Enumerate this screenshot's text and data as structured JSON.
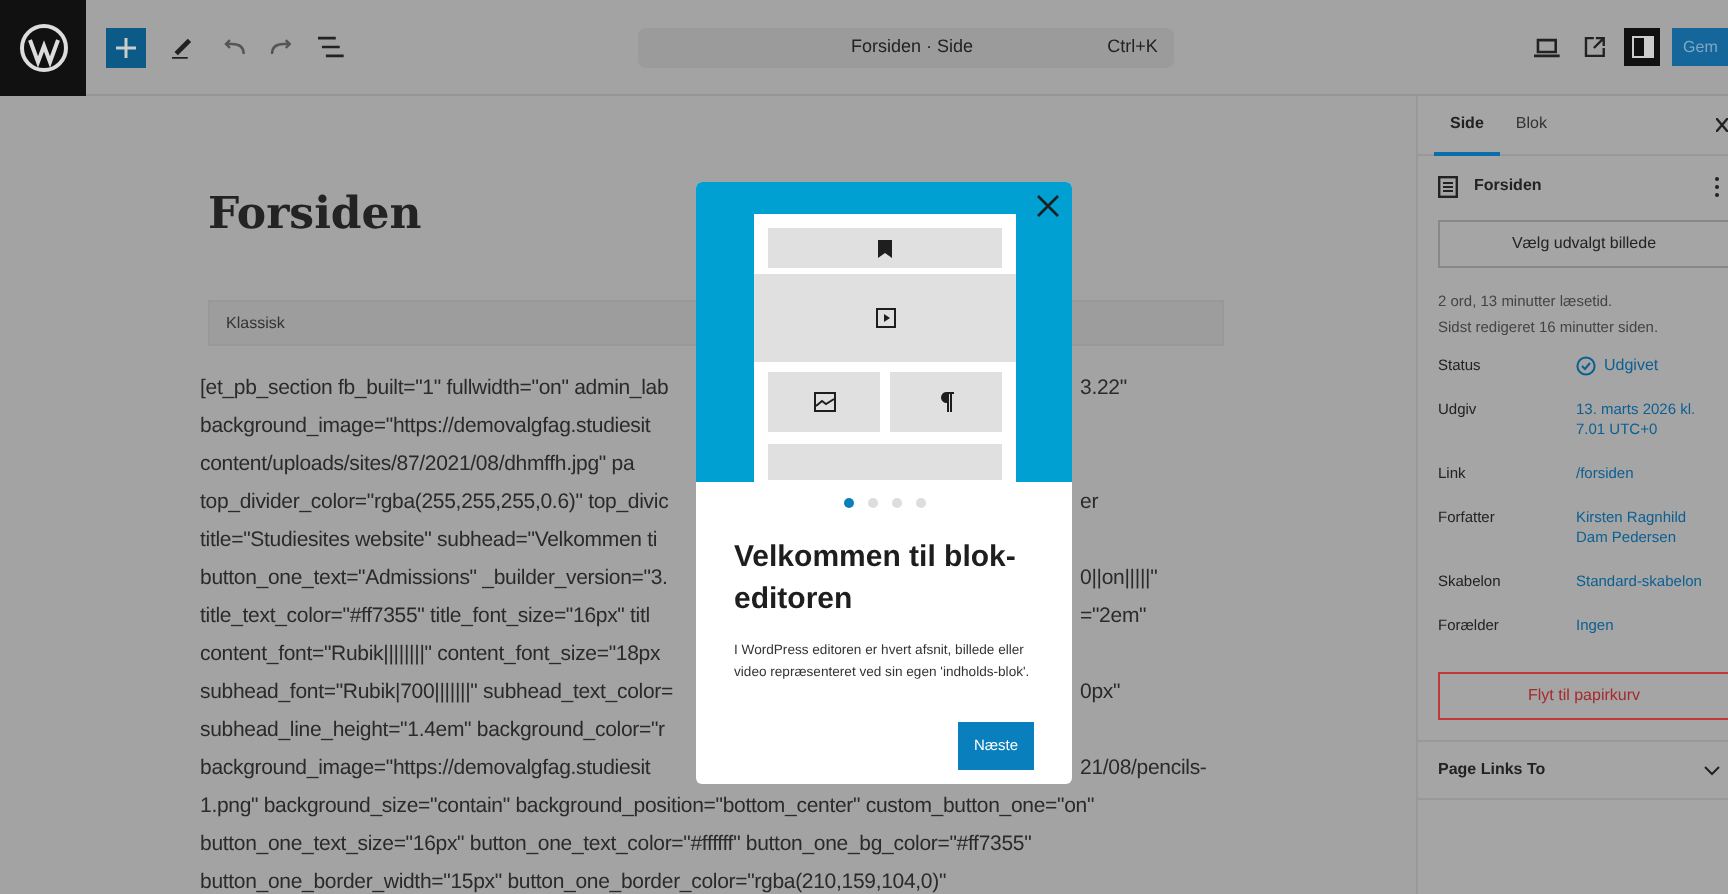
{
  "toolbar": {
    "document_title": "Forsiden · Side",
    "shortcut": "Ctrl+K",
    "save_button": "Gem"
  },
  "editor": {
    "title": "Forsiden",
    "block_label": "Klassisk",
    "lines": [
      {
        "kind": "split",
        "left": "[et_pb_section fb_built=\"1\" fullwidth=\"on\" admin_lab",
        "right": "3.22\""
      },
      {
        "kind": "split",
        "left": "background_image=\"https://demovalgfag.studiesit"
      },
      {
        "kind": "split",
        "left": "content/uploads/sites/87/2021/08/dhmffh.jpg\" pa"
      },
      {
        "kind": "split",
        "left": "top_divider_color=\"rgba(255,255,255,0.6)\" top_divic",
        "right": "er"
      },
      {
        "kind": "split",
        "left": "title=\"Studiesites website\" subhead=\"Velkommen ti"
      },
      {
        "kind": "split",
        "left": "button_one_text=\"Admissions\" _builder_version=\"3.",
        "right": "0||on|||||\""
      },
      {
        "kind": "split",
        "left": "title_text_color=\"#ff7355\" title_font_size=\"16px\" titl",
        "right": "=\"2em\""
      },
      {
        "kind": "split",
        "left": "content_font=\"Rubik||||||||\" content_font_size=\"18px"
      },
      {
        "kind": "split",
        "left": "subhead_font=\"Rubik|700|||||||\" subhead_text_color=",
        "right": "0px\""
      },
      {
        "kind": "split",
        "left": "subhead_line_height=\"1.4em\" background_color=\"r"
      },
      {
        "kind": "split",
        "left": "background_image=\"https://demovalgfag.studiesit",
        "right": "21/08/pencils-"
      },
      {
        "kind": "full",
        "left": "1.png\" background_size=\"contain\" background_position=\"bottom_center\" custom_button_one=\"on\""
      },
      {
        "kind": "full",
        "left": "button_one_text_size=\"16px\" button_one_text_color=\"#ffffff\" button_one_bg_color=\"#ff7355\""
      },
      {
        "kind": "full",
        "left": "button_one_border_width=\"15px\" button_one_border_color=\"rgba(210,159,104,0)\""
      }
    ]
  },
  "modal": {
    "pages": [
      {
        "selected": true
      },
      {
        "selected": false
      },
      {
        "selected": false
      },
      {
        "selected": false
      }
    ],
    "title": "Velkommen til blok-editoren",
    "body": "I WordPress editoren er hvert afsnit, billede eller video repræsenteret ved sin egen 'indholds-blok'.",
    "button": "Næste"
  },
  "sidebar": {
    "tabs": [
      {
        "label": "Side",
        "selected": true
      },
      {
        "label": "Blok",
        "selected": false
      }
    ],
    "page_title": "Forsiden",
    "featured_image_button": "Vælg udvalgt billede",
    "stats": [
      "2 ord, 13 minutter læsetid.",
      "Sidst redigeret 16 minutter siden."
    ],
    "fields": [
      {
        "kind": "status",
        "label": "Status",
        "value": "Udgivet"
      },
      {
        "kind": "link",
        "label": "Udgiv",
        "value": "13. marts 2026 kl. 7.01 UTC+0"
      },
      {
        "kind": "link",
        "label": "Link",
        "value": "/forsiden"
      },
      {
        "kind": "link",
        "label": "Forfatter",
        "value": "Kirsten Ragnhild Dam Pedersen"
      },
      {
        "kind": "link",
        "label": "Skabelon",
        "value": "Standard-skabelon"
      },
      {
        "kind": "link",
        "label": "Forælder",
        "value": "Ingen"
      }
    ],
    "trash_button": "Flyt til papirkurv",
    "panel": {
      "title": "Page Links To",
      "expanded": false
    }
  }
}
